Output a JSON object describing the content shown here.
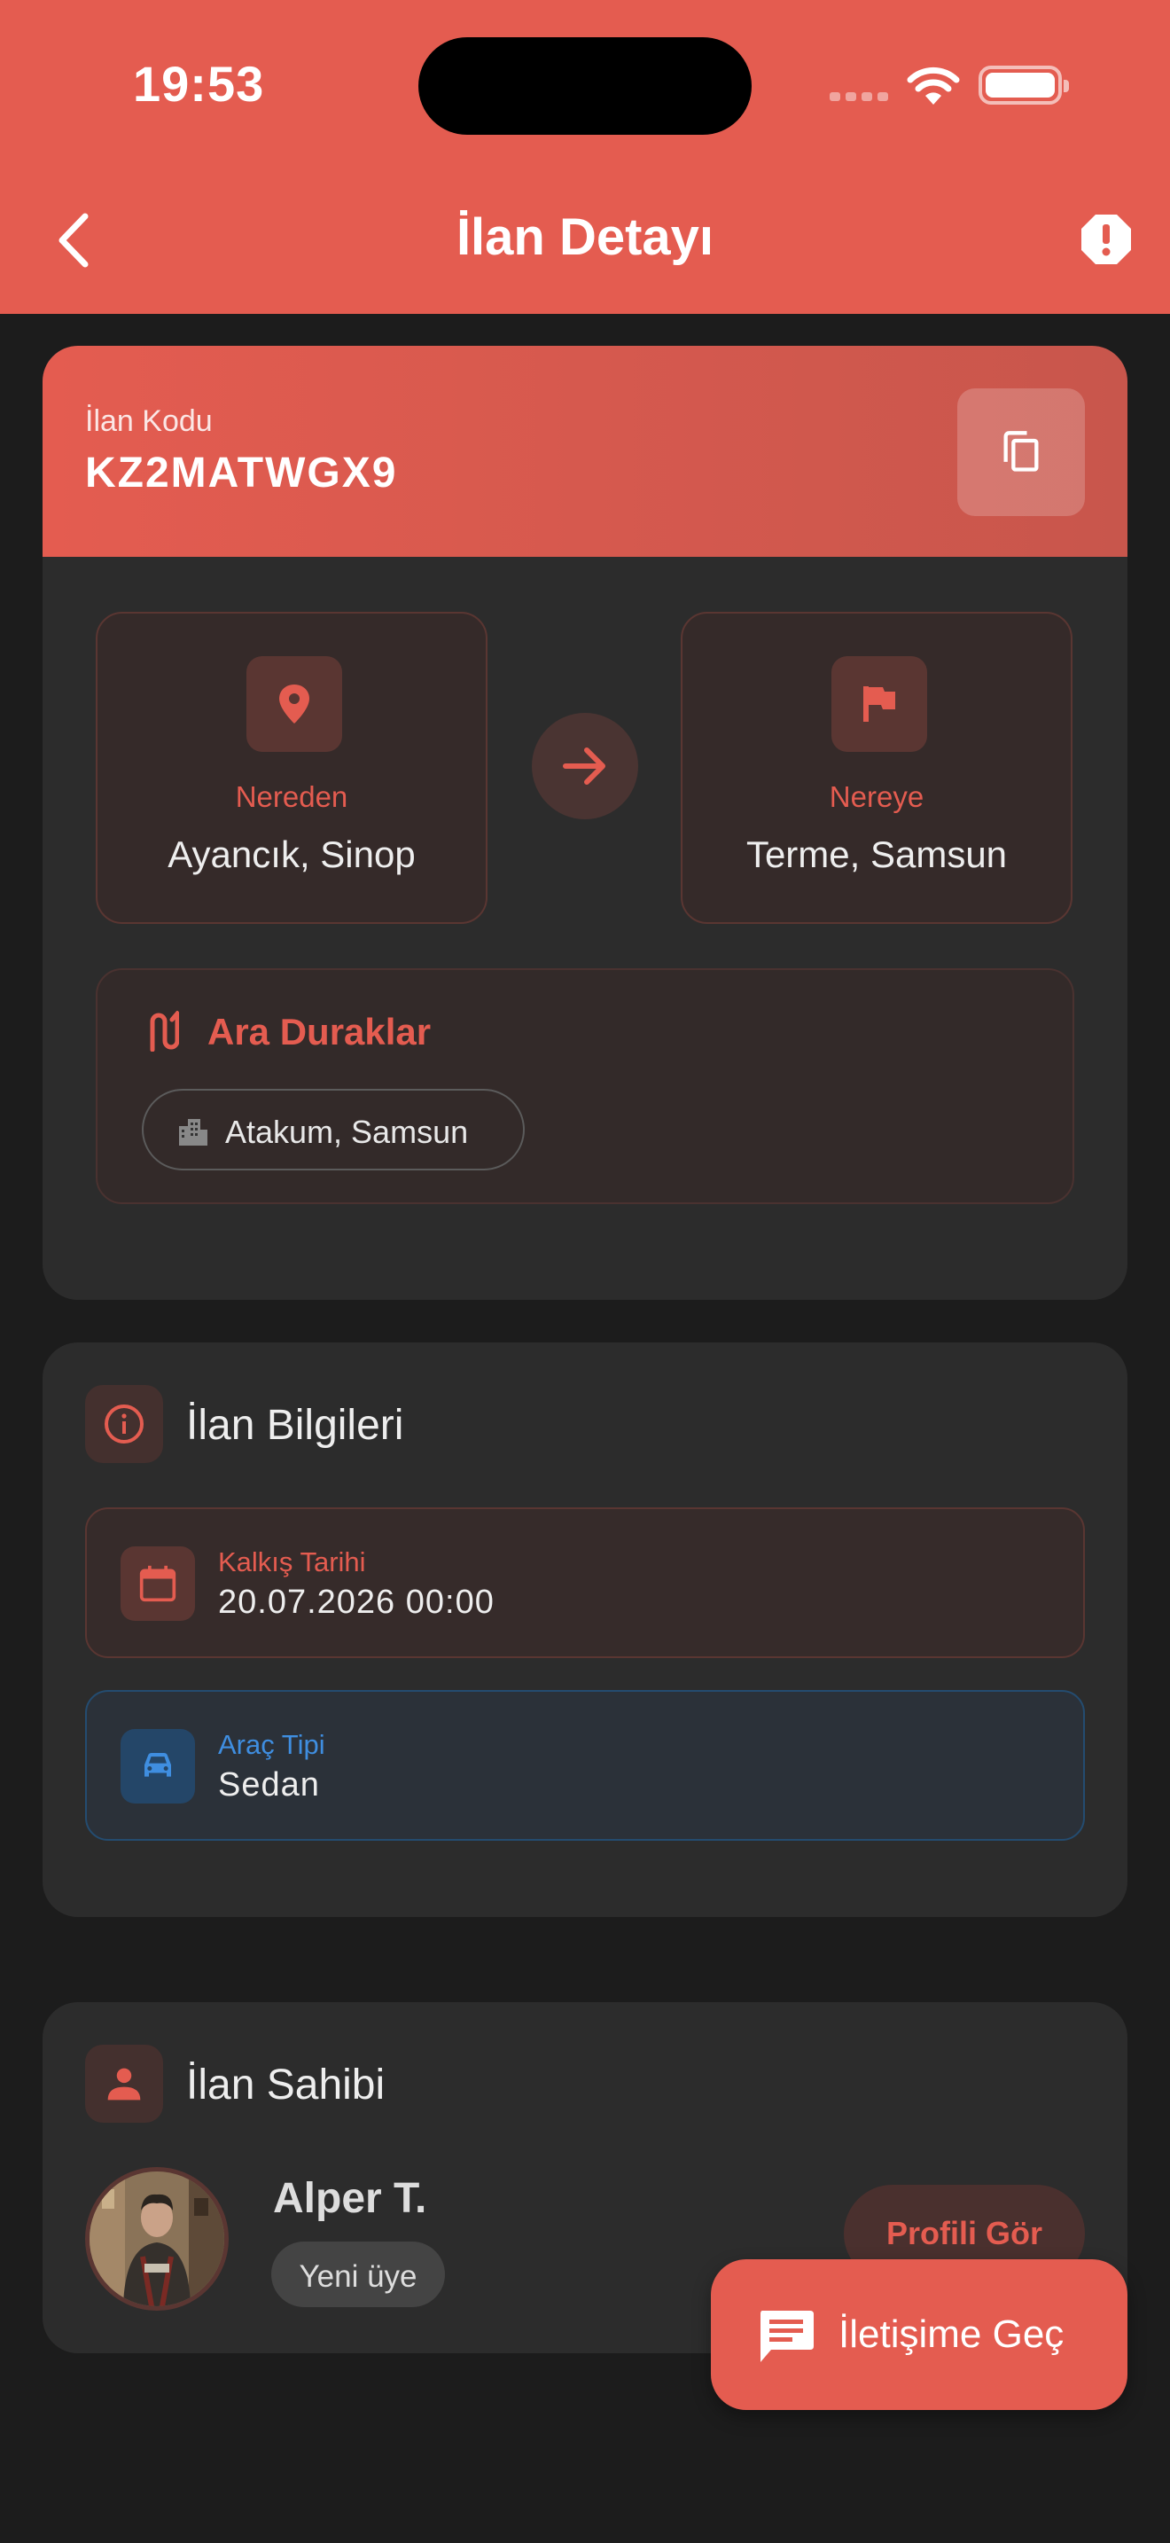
{
  "status_bar": {
    "time": "19:53"
  },
  "nav": {
    "title": "İlan Detayı"
  },
  "listing": {
    "code_label": "İlan Kodu",
    "code": "KZ2MATWGX9"
  },
  "route": {
    "from_label": "Nereden",
    "from_value": "Ayancık, Sinop",
    "to_label": "Nereye",
    "to_value": "Terme, Samsun",
    "stops_title": "Ara Duraklar",
    "stops": [
      "Atakum, Samsun"
    ]
  },
  "info": {
    "title": "İlan Bilgileri",
    "departure_label": "Kalkış Tarihi",
    "departure_value": "20.07.2026 00:00",
    "vehicle_label": "Araç Tipi",
    "vehicle_value": "Sedan"
  },
  "owner": {
    "title": "İlan Sahibi",
    "name": "Alper T.",
    "badge": "Yeni üye",
    "profile_button": "Profili Gör"
  },
  "fab": {
    "label": "İletişime Geç"
  },
  "colors": {
    "accent": "#e45c50",
    "background": "#1c1c1c",
    "card": "#2c2c2c",
    "info_blue": "#3f8ee0"
  },
  "icons": [
    "back-arrow-icon",
    "report-icon",
    "copy-icon",
    "location-pin-icon",
    "flag-icon",
    "arrow-right-icon",
    "route-icon",
    "city-icon",
    "info-icon",
    "calendar-icon",
    "car-icon",
    "person-icon",
    "chat-icon"
  ]
}
